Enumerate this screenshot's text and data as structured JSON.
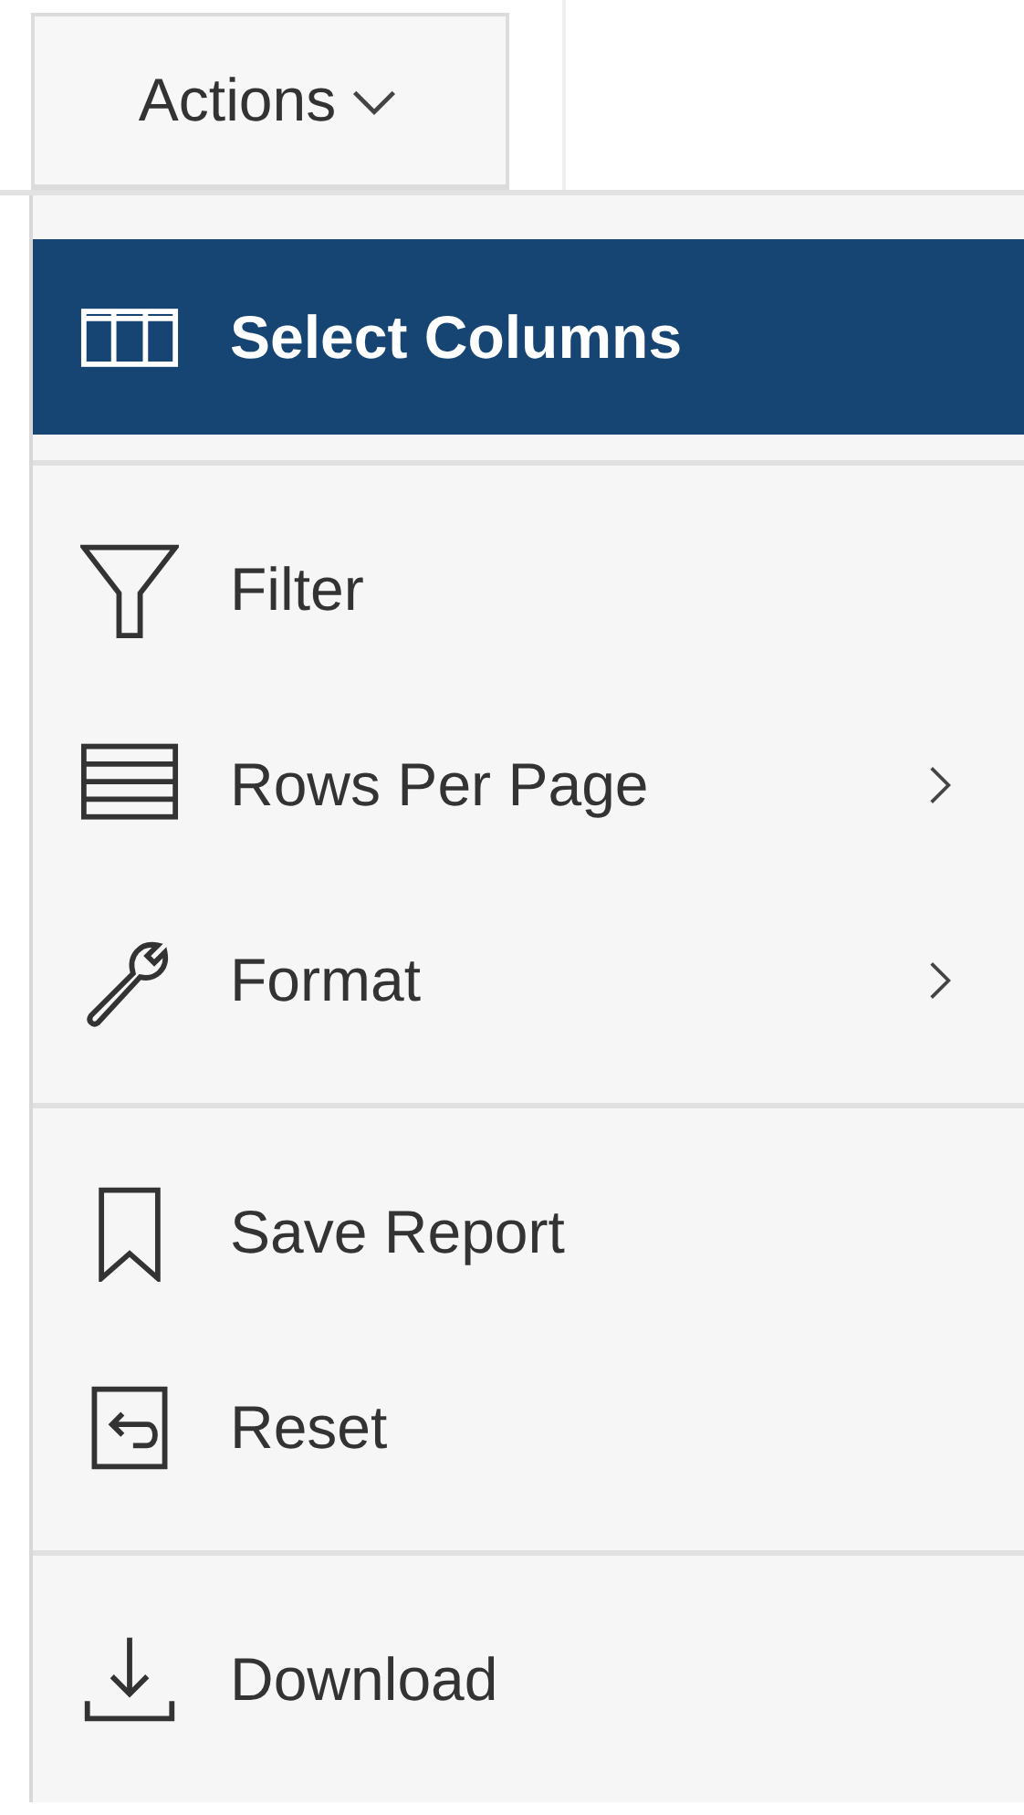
{
  "actions_button": {
    "label": "Actions"
  },
  "menu": {
    "groups": [
      {
        "items": [
          {
            "label": "Select Columns",
            "selected": true,
            "submenu": false
          }
        ]
      },
      {
        "items": [
          {
            "label": "Filter",
            "selected": false,
            "submenu": false
          },
          {
            "label": "Rows Per Page",
            "selected": false,
            "submenu": true
          },
          {
            "label": "Format",
            "selected": false,
            "submenu": true
          }
        ]
      },
      {
        "items": [
          {
            "label": "Save Report",
            "selected": false,
            "submenu": false
          },
          {
            "label": "Reset",
            "selected": false,
            "submenu": false
          }
        ]
      },
      {
        "items": [
          {
            "label": "Download",
            "selected": false,
            "submenu": false
          }
        ]
      }
    ]
  }
}
